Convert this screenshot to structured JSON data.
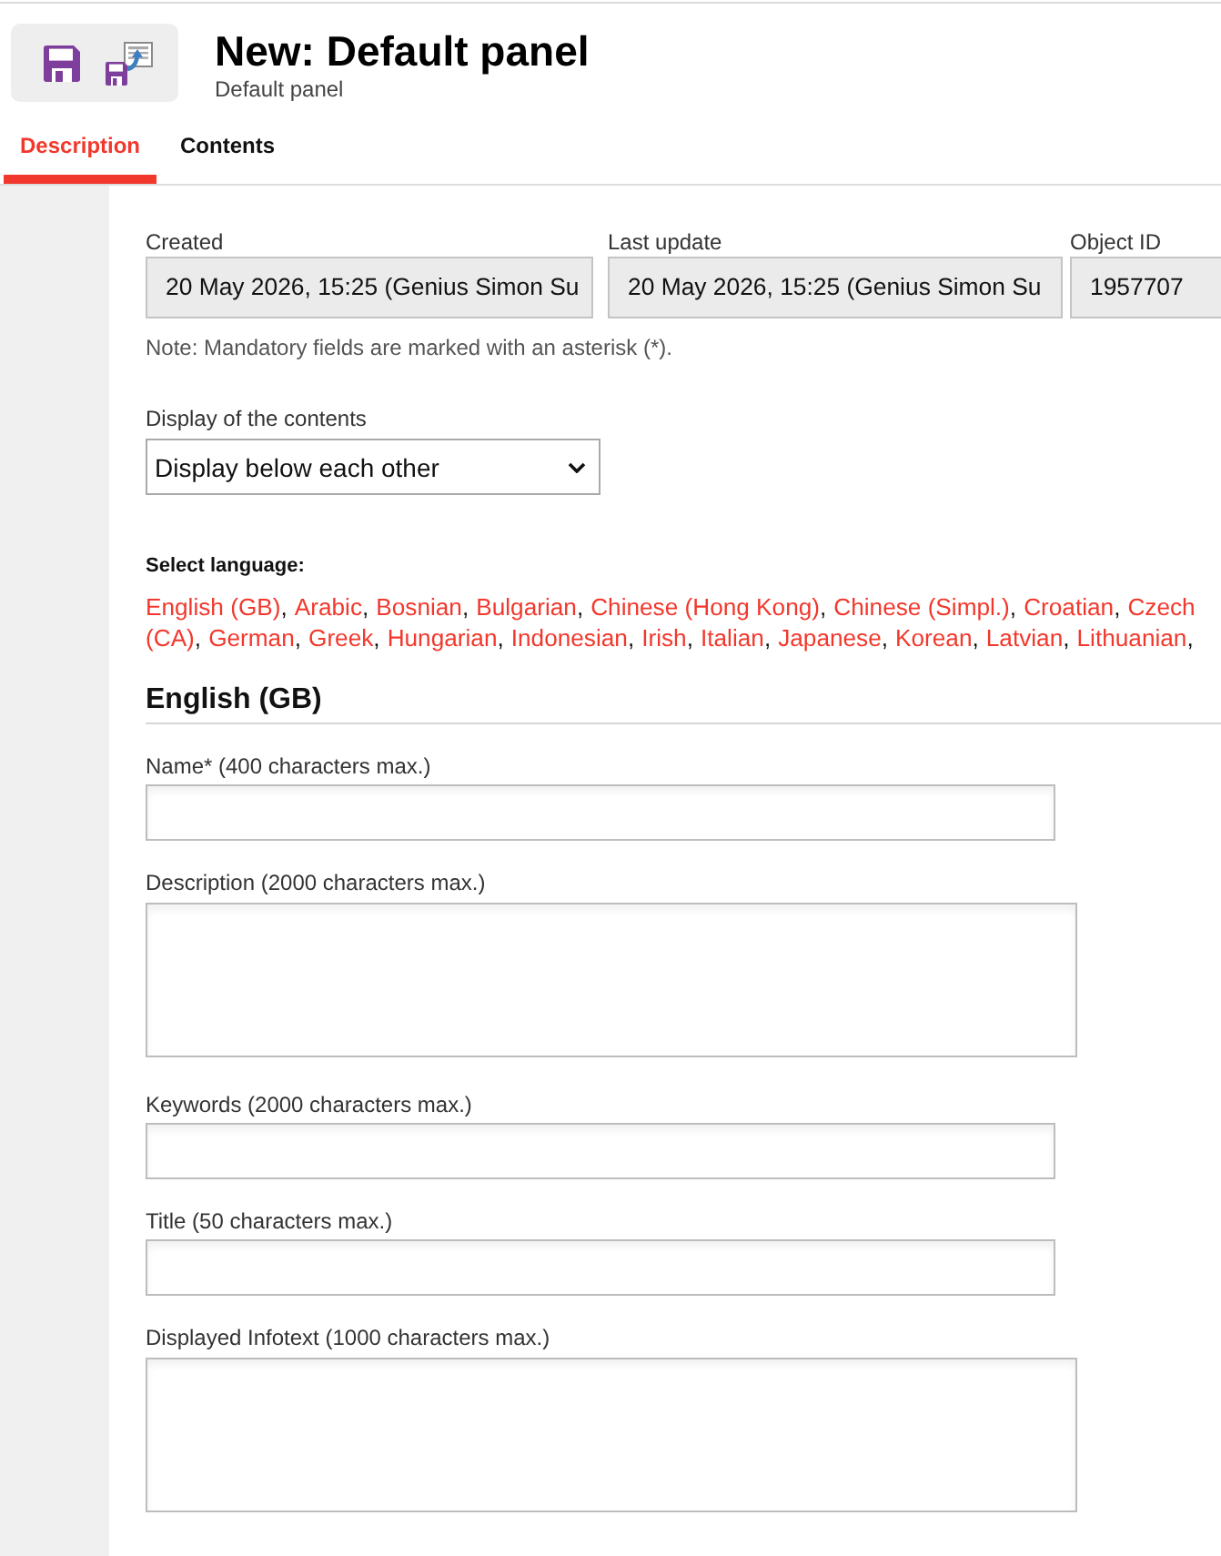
{
  "header": {
    "title": "New: Default panel",
    "subtitle": "Default panel"
  },
  "tabs": [
    {
      "label": "Description",
      "selected": true
    },
    {
      "label": "Contents",
      "selected": false
    }
  ],
  "meta_fields": [
    {
      "label": "Created",
      "value": "20 May 2026, 15:25 (Genius Simon Su"
    },
    {
      "label": "Last update",
      "value": "20 May 2026, 15:25 (Genius Simon Su"
    },
    {
      "label": "Object ID",
      "value": "1957707"
    }
  ],
  "note": "Note: Mandatory fields are marked with an asterisk (*).",
  "display": {
    "label": "Display of the contents",
    "value": "Display below each other"
  },
  "languages": {
    "label": "Select language:",
    "lines": [
      [
        {
          "name": "English (GB)",
          "after": ","
        },
        {
          "name": "Arabic",
          "after": ","
        },
        {
          "name": "Bosnian",
          "after": ","
        },
        {
          "name": "Bulgarian",
          "after": ","
        },
        {
          "name": "Chinese (Hong Kong)",
          "after": ","
        },
        {
          "name": "Chinese (Simpl.)",
          "after": ","
        },
        {
          "name": "Croatian",
          "after": ","
        },
        {
          "name": "Czech"
        }
      ],
      [
        {
          "name": "(CA)",
          "after": ","
        },
        {
          "name": "German",
          "after": ","
        },
        {
          "name": "Greek",
          "after": ","
        },
        {
          "name": "Hungarian",
          "after": ","
        },
        {
          "name": "Indonesian",
          "after": ","
        },
        {
          "name": "Irish",
          "after": ","
        },
        {
          "name": "Italian",
          "after": ","
        },
        {
          "name": "Japanese",
          "after": ","
        },
        {
          "name": "Korean",
          "after": ","
        },
        {
          "name": "Latvian",
          "after": ","
        },
        {
          "name": "Lithuanian",
          "after": ","
        }
      ]
    ]
  },
  "section": {
    "heading": "English (GB)",
    "fields": [
      {
        "label": "Name* (400 characters max.)",
        "kind": "input"
      },
      {
        "label": "Description (2000 characters max.)",
        "kind": "textarea"
      },
      {
        "label": "Keywords (2000 characters max.)",
        "kind": "input"
      },
      {
        "label": "Title (50 characters max.)",
        "kind": "input"
      },
      {
        "label": "Displayed Infotext (1000 characters max.)",
        "kind": "textarea"
      }
    ]
  }
}
